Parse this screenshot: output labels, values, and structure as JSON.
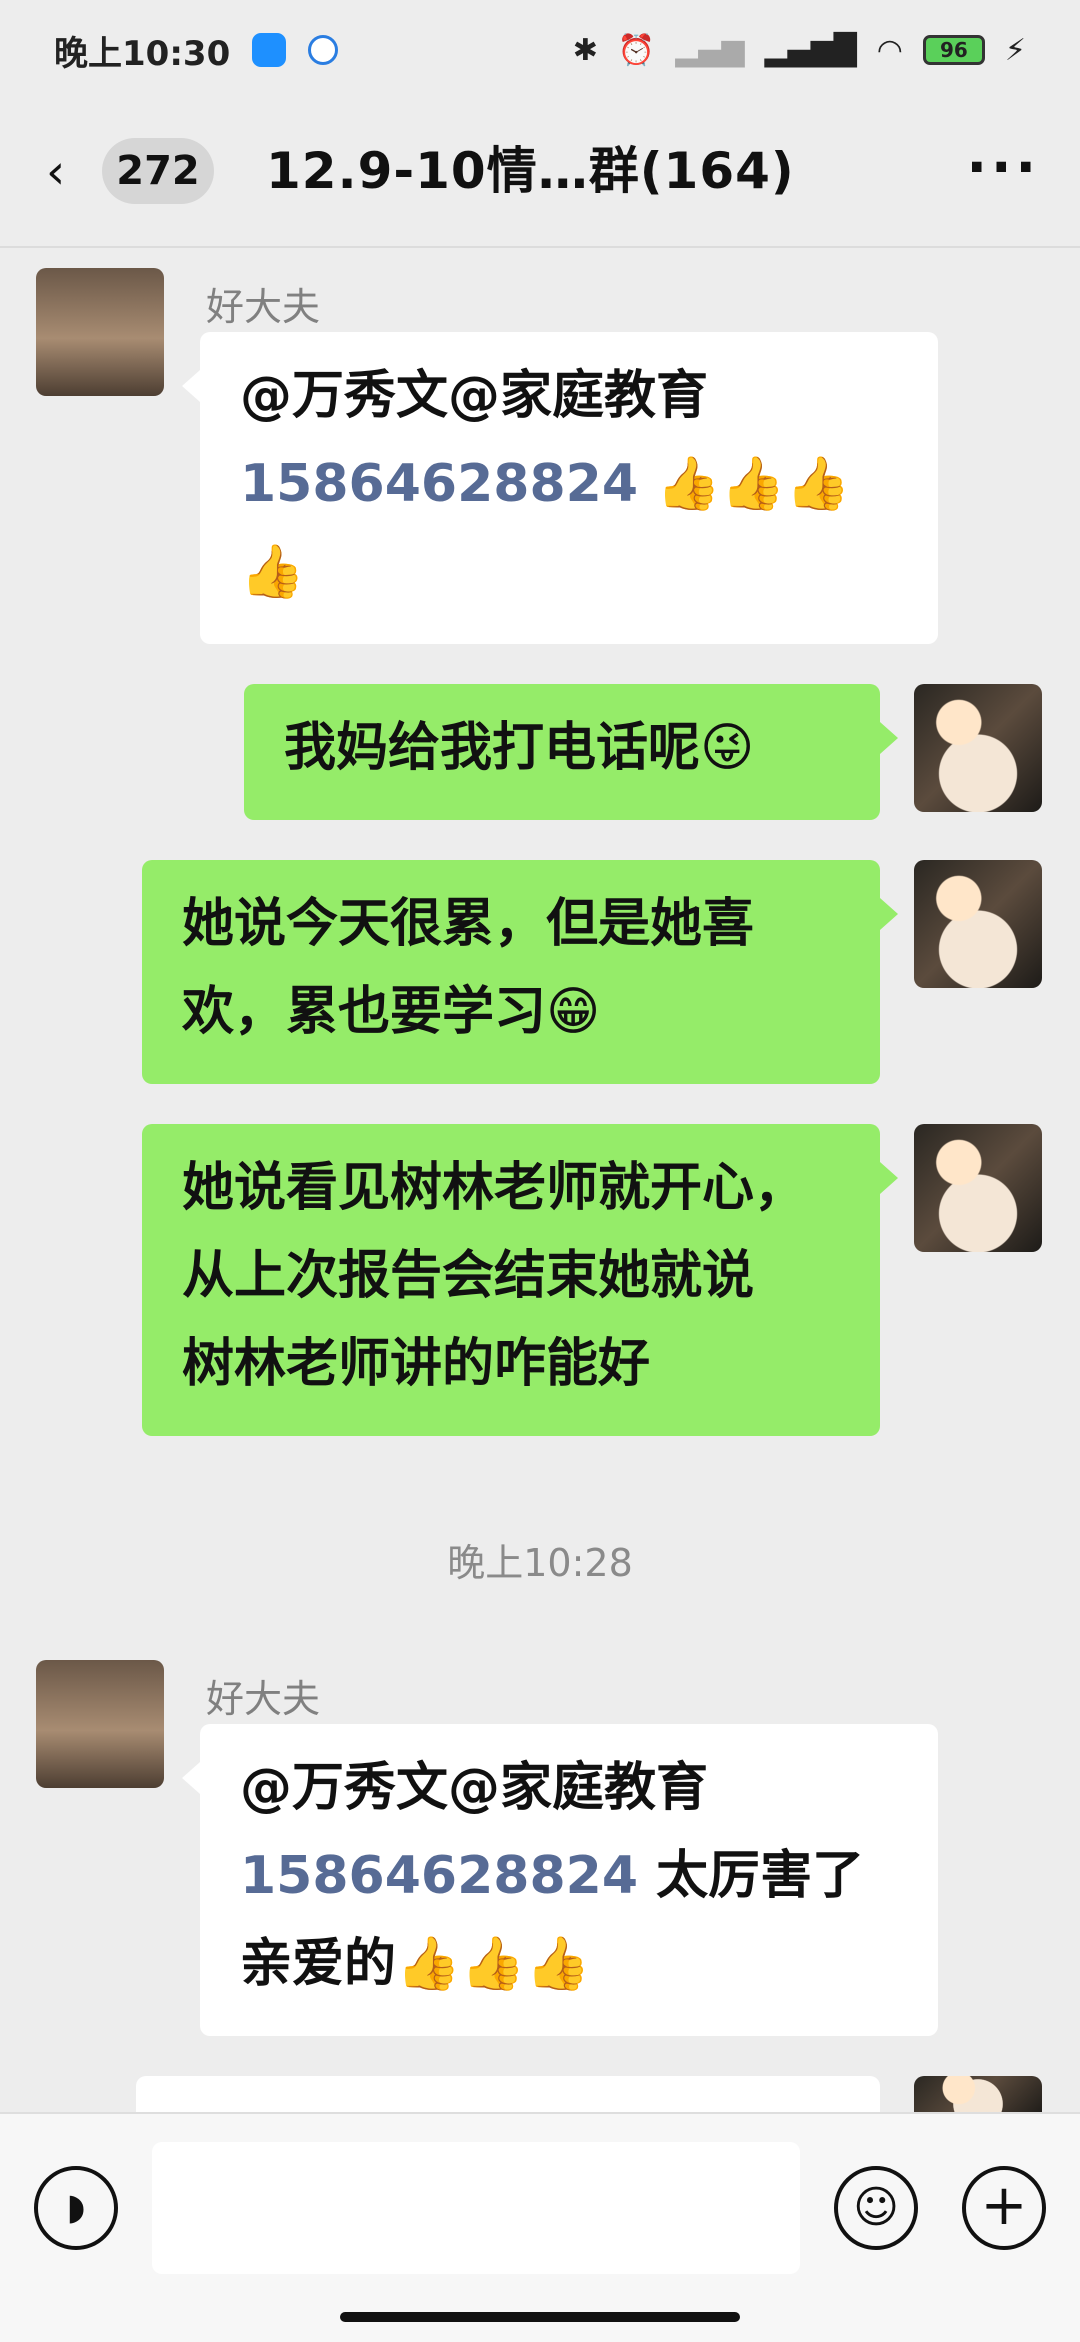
{
  "status_bar": {
    "time": "晚上10:30",
    "battery": "96",
    "icons": [
      "app-icon",
      "app-icon-2",
      "bluetooth-icon",
      "alarm-icon",
      "signal-icon",
      "hd-signal-icon",
      "wifi-icon",
      "battery-icon",
      "charging-icon"
    ]
  },
  "header": {
    "back_icon": "chevron-left-icon",
    "unread_count": "272",
    "title": "12.9-10情…群(164)",
    "more_icon": "more-icon"
  },
  "messages": [
    {
      "side": "them",
      "sender": "好大夫",
      "line1": "@万秀文@家庭教育",
      "phone": "15864628824",
      "emoji_a": "👍👍👍",
      "emoji_b": "👍"
    },
    {
      "side": "me",
      "text": "我妈给我打电话呢😜"
    },
    {
      "side": "me",
      "line1": "她说今天很累，但是她喜",
      "line2": "欢，累也要学习😁"
    },
    {
      "side": "me",
      "line1": "她说看见树林老师就开心，",
      "line2": "从上次报告会结束她就说",
      "line3": "树林老师讲的咋能好"
    },
    {
      "side": "them",
      "sender": "好大夫",
      "line1": "@万秀文@家庭教育",
      "phone": "15864628824",
      "tail": " 太厉害了",
      "line3": "亲爱的👍👍👍"
    }
  ],
  "time_separator": "晚上10:28",
  "input_bar": {
    "voice_icon": "voice-icon",
    "emoji_icon": "emoji-icon",
    "plus_icon": "plus-icon"
  },
  "colors": {
    "background": "#ededed",
    "my_bubble": "#95ec69",
    "their_bubble": "#ffffff",
    "link": "#576b95"
  }
}
